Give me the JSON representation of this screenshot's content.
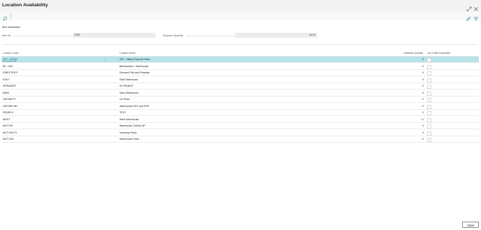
{
  "window": {
    "title": "Location Availability"
  },
  "toolbar": {
    "icons": [
      "search-icon",
      "edit-icon",
      "filter-icon"
    ]
  },
  "item_info": {
    "section_title": "Item Information",
    "item_no_label": "Item No.",
    "item_no_value": "2256",
    "required_qty_label": "Required Quantity",
    "required_qty_value": "16.00"
  },
  "table": {
    "headers": {
      "code": "Location Code ↑",
      "name": "Location Name",
      "qty": "Available Quantity",
      "fulfill": "Can Fulfill Completely"
    },
    "rows": [
      {
        "code": "2FP - OFHW",
        "name": "2FP - Oilera Para H/o West",
        "qty": "0"
      },
      {
        "code": "BC - WH",
        "name": "Belchamters - Warehouse",
        "qty": "0"
      },
      {
        "code": "DIRECTED P",
        "name": "Directed Pick and Putaway",
        "qty": "0"
      },
      {
        "code": "EAST",
        "name": "East Warehouse",
        "qty": "0"
      },
      {
        "code": "INTRANSIT",
        "name": "IN TRANSIT",
        "qty": "0"
      },
      {
        "code": "MAIN",
        "name": "Main Warehouse",
        "qty": "0"
      },
      {
        "code": "ONTIME PI",
        "name": "Inv Picks",
        "qty": "0"
      },
      {
        "code": "ONTIME WH",
        "name": "Warehouse RCV and SHP",
        "qty": "0"
      },
      {
        "code": "REQRCV",
        "name": "TEST",
        "qty": "0"
      },
      {
        "code": "WEST",
        "name": "West Warehouse",
        "qty": "10"
      },
      {
        "code": "WOT DP",
        "name": "Warehouse Ontime DP",
        "qty": "0"
      },
      {
        "code": "WOT INV PI",
        "name": "Inventory Picks",
        "qty": "0"
      },
      {
        "code": "WOT WH",
        "name": "Warehouse Picks",
        "qty": "0"
      }
    ]
  },
  "footer": {
    "close_label": "Close"
  },
  "colors": {
    "accent": "#0f8c93",
    "selected_row": "#b7e3e9"
  }
}
